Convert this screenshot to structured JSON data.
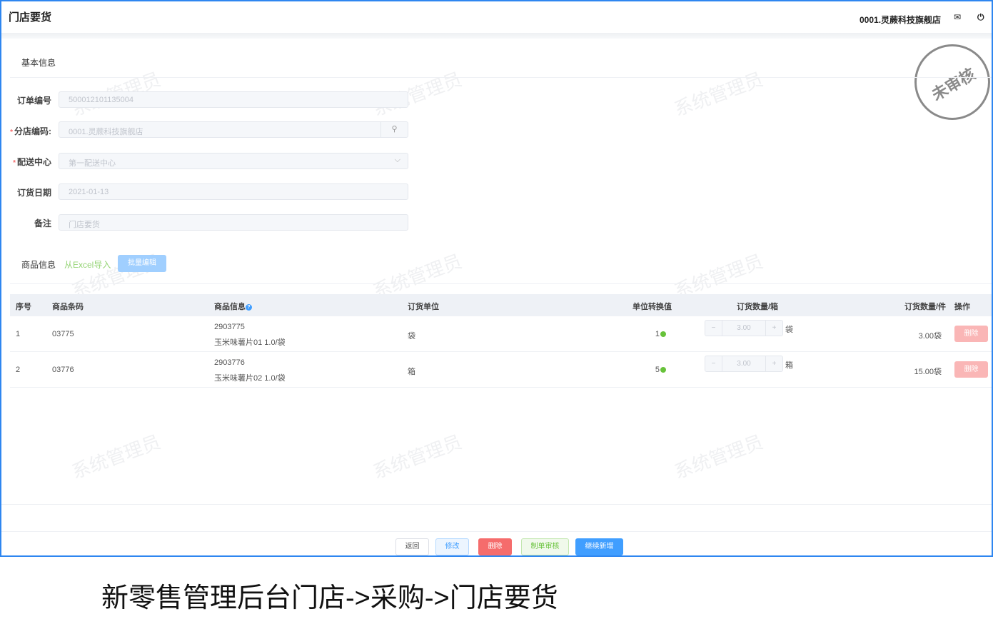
{
  "header": {
    "title": "门店要货",
    "store": "0001.灵蕨科技旗舰店"
  },
  "stamp": "未审核",
  "watermark": "系统管理员",
  "basic": {
    "section": "基本信息",
    "fields": [
      {
        "label": "订单编号",
        "value": "500012101135004",
        "required": false
      },
      {
        "label": "分店编码:",
        "value": "0001.灵蕨科技旗舰店",
        "required": true
      },
      {
        "label": "配送中心",
        "value": "第一配送中心",
        "required": true
      },
      {
        "label": "订货日期",
        "value": "2021-01-13",
        "required": false
      },
      {
        "label": "备注",
        "value": "门店要货",
        "required": false
      }
    ]
  },
  "goods": {
    "section": "商品信息",
    "import_link": "从Excel导入",
    "batch_edit": "批量编辑"
  },
  "table": {
    "columns": [
      "序号",
      "商品条码",
      "商品信息",
      "订货单位",
      "单位转换值",
      "订货数量/箱",
      "订货数量/件",
      "操作"
    ],
    "rows": [
      {
        "no": "1",
        "barcode": "03775",
        "code": "2903775",
        "name": "玉米味薯片01 1.0/袋",
        "unit": "袋",
        "ratio": "1",
        "qty": "3.00",
        "qty_unit": "袋",
        "pieces": "3.00袋",
        "action": "删除"
      },
      {
        "no": "2",
        "barcode": "03776",
        "code": "2903776",
        "name": "玉米味薯片02 1.0/袋",
        "unit": "箱",
        "ratio": "5",
        "qty": "3.00",
        "qty_unit": "箱",
        "pieces": "15.00袋",
        "action": "删除"
      }
    ]
  },
  "footer": {
    "back": "返回",
    "edit": "修改",
    "delete": "删除",
    "audit": "制单审核",
    "continue": "继续新增"
  },
  "caption": "新零售管理后台门店->采购->门店要货"
}
